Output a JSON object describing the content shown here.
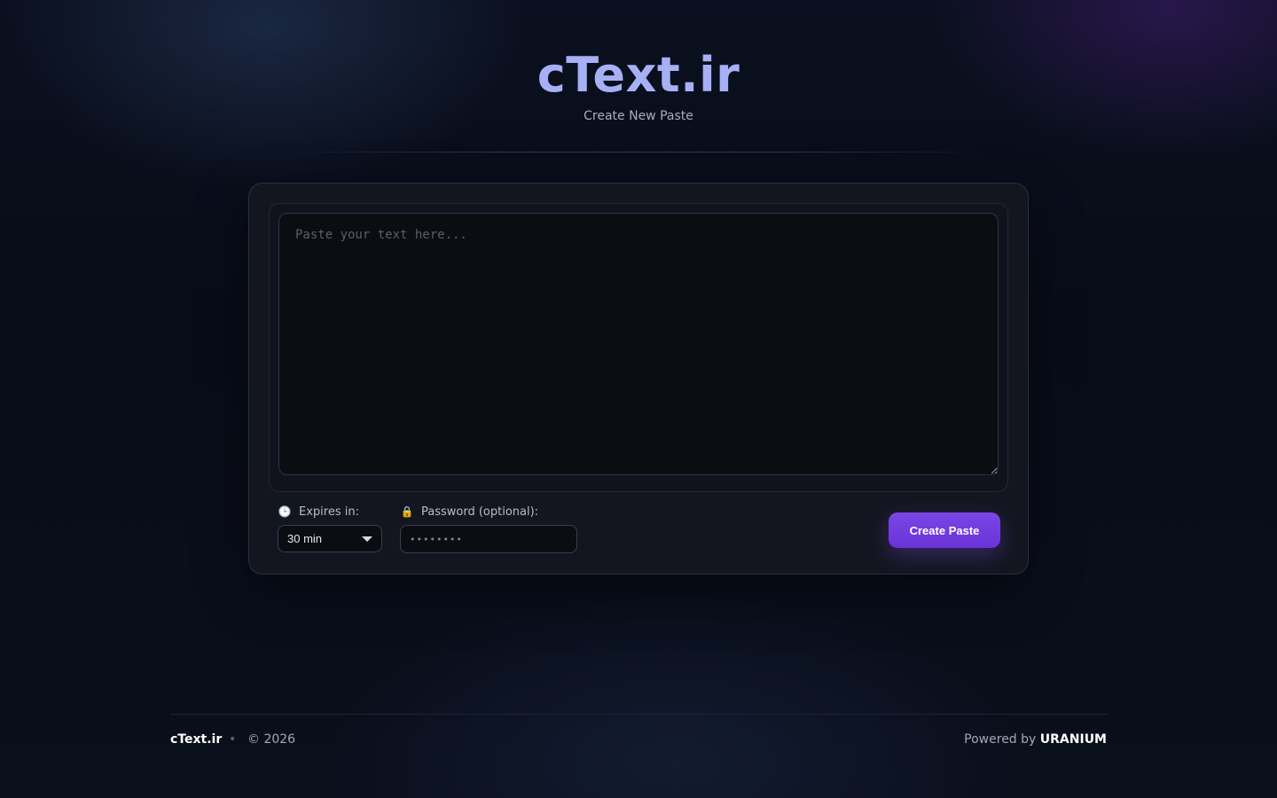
{
  "header": {
    "logo": "cText.ir",
    "subtitle": "Create New Paste"
  },
  "editor": {
    "placeholder": "Paste your text here...",
    "value": ""
  },
  "options": {
    "expires_icon": "🕒",
    "expires_label": "Expires in:",
    "expires_value": "30 min",
    "password_icon": "🔒",
    "password_label": "Password (optional):",
    "password_placeholder": "••••••••"
  },
  "actions": {
    "create_label": "Create Paste"
  },
  "footer": {
    "brand": "cText.ir",
    "separator": "•",
    "copyright": "© 2026",
    "powered_prefix": "Powered by",
    "powered_brand": "URANIUM"
  },
  "colors": {
    "accent": "#7b45e8",
    "logo": "#a7b0f5",
    "background": "#080c17"
  }
}
